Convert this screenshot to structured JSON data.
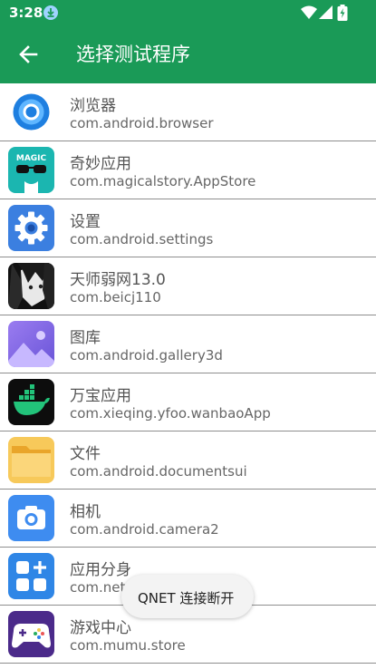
{
  "status": {
    "time": "3:28"
  },
  "toolbar": {
    "title": "选择测试程序"
  },
  "apps": [
    {
      "name": "浏览器",
      "package": "com.android.browser",
      "icon": "browser-icon"
    },
    {
      "name": "奇妙应用",
      "package": "com.magicalstory.AppStore",
      "icon": "magic-icon",
      "icon_text": "MAGIC"
    },
    {
      "name": "设置",
      "package": "com.android.settings",
      "icon": "gear-icon"
    },
    {
      "name": "天师弱网13.0",
      "package": "com.beicj110",
      "icon": "anime-avatar-icon"
    },
    {
      "name": "图库",
      "package": "com.android.gallery3d",
      "icon": "gallery-icon"
    },
    {
      "name": "万宝应用",
      "package": "com.xieqing.yfoo.wanbaoApp",
      "icon": "docker-whale-icon"
    },
    {
      "name": "文件",
      "package": "com.android.documentsui",
      "icon": "folder-icon"
    },
    {
      "name": "相机",
      "package": "com.android.camera2",
      "icon": "camera-icon"
    },
    {
      "name": "应用分身",
      "package": "com.net",
      "icon": "clone-apps-icon"
    },
    {
      "name": "游戏中心",
      "package": "com.mumu.store",
      "icon": "gamepad-icon"
    }
  ],
  "toast": {
    "text": "QNET 连接断开"
  },
  "colors": {
    "toolbar": "#1a9a57",
    "divider": "#8e8e8e"
  }
}
